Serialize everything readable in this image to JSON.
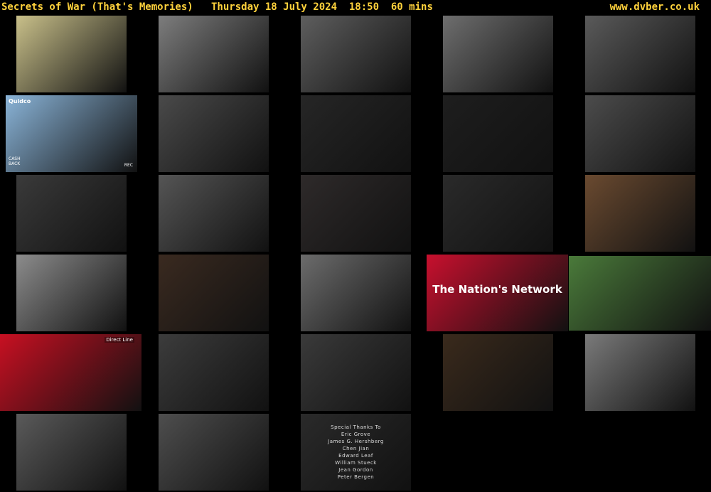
{
  "header": {
    "title": "Secrets of War (That's Memories)   Thursday 18 July 2024  18:50  60 mins",
    "site": "www.dvber.co.uk"
  },
  "frames": [
    {
      "name": "frame-document",
      "bg": "#c9c08a"
    },
    {
      "name": "frame-marching-troops",
      "bg": "#7d7d7d"
    },
    {
      "name": "frame-crowd-soldiers",
      "bg": "#5e5e5e"
    },
    {
      "name": "frame-officers-office",
      "bg": "#6e6e6e"
    },
    {
      "name": "frame-rice-field",
      "bg": "#5a5a5a"
    },
    {
      "name": "frame-quidco-ad",
      "bg": "#8ab4d8"
    },
    {
      "name": "frame-general-smiling",
      "bg": "#4a4a4a"
    },
    {
      "name": "frame-dark-scene-1",
      "bg": "#262626"
    },
    {
      "name": "frame-dark-scene-2",
      "bg": "#1e1e1e"
    },
    {
      "name": "frame-conference-table",
      "bg": "#4c4c4c"
    },
    {
      "name": "frame-assembly-hall",
      "bg": "#3a3a3a"
    },
    {
      "name": "frame-soldiers-march",
      "bg": "#555555"
    },
    {
      "name": "frame-man-podium",
      "bg": "#2e2a2a"
    },
    {
      "name": "frame-dark-interior",
      "bg": "#2a2a2a"
    },
    {
      "name": "frame-interview-chen",
      "bg": "#6a4a30"
    },
    {
      "name": "frame-portraits-ceremony",
      "bg": "#8c8c8c"
    },
    {
      "name": "frame-interview-man-1",
      "bg": "#3a2a20"
    },
    {
      "name": "frame-winter-troops",
      "bg": "#6c6c6c"
    },
    {
      "name": "frame-vodafone-ad",
      "bg": "#c8102e"
    },
    {
      "name": "frame-soldiers-resting",
      "bg": "#4a7a3a"
    },
    {
      "name": "frame-direct-line-ad",
      "bg": "#c81022"
    },
    {
      "name": "frame-children-faces",
      "bg": "#3c3c3c"
    },
    {
      "name": "frame-leaders-portrait",
      "bg": "#3a3a3a"
    },
    {
      "name": "frame-interview-man-2",
      "bg": "#3a2a1c"
    },
    {
      "name": "frame-troops-mountain",
      "bg": "#7a7a7a"
    },
    {
      "name": "frame-handshake",
      "bg": "#5a5a5a"
    },
    {
      "name": "frame-jungle-soldiers",
      "bg": "#4e4e4e"
    },
    {
      "name": "frame-end-credits",
      "bg": "#2a2a2a"
    }
  ],
  "ads": {
    "quidco_logo": "Quidco",
    "quidco_cashback": "CASH\nBACK",
    "quidco_rec": "REC",
    "vodafone_tagline": "The Nation's Network",
    "direct_line_logo": "Direct Line"
  },
  "credits": {
    "lines": [
      "Special Thanks To",
      "Eric Grove",
      "James G. Hershberg",
      "Chen Jian",
      "Edward Leaf",
      "William Stueck",
      "Jean Gordon",
      "Peter Bergen"
    ]
  },
  "colors": {
    "header_text": "#ffd23c",
    "background": "#000000",
    "vodafone_red": "#c8102e",
    "direct_line_red": "#c81022"
  }
}
